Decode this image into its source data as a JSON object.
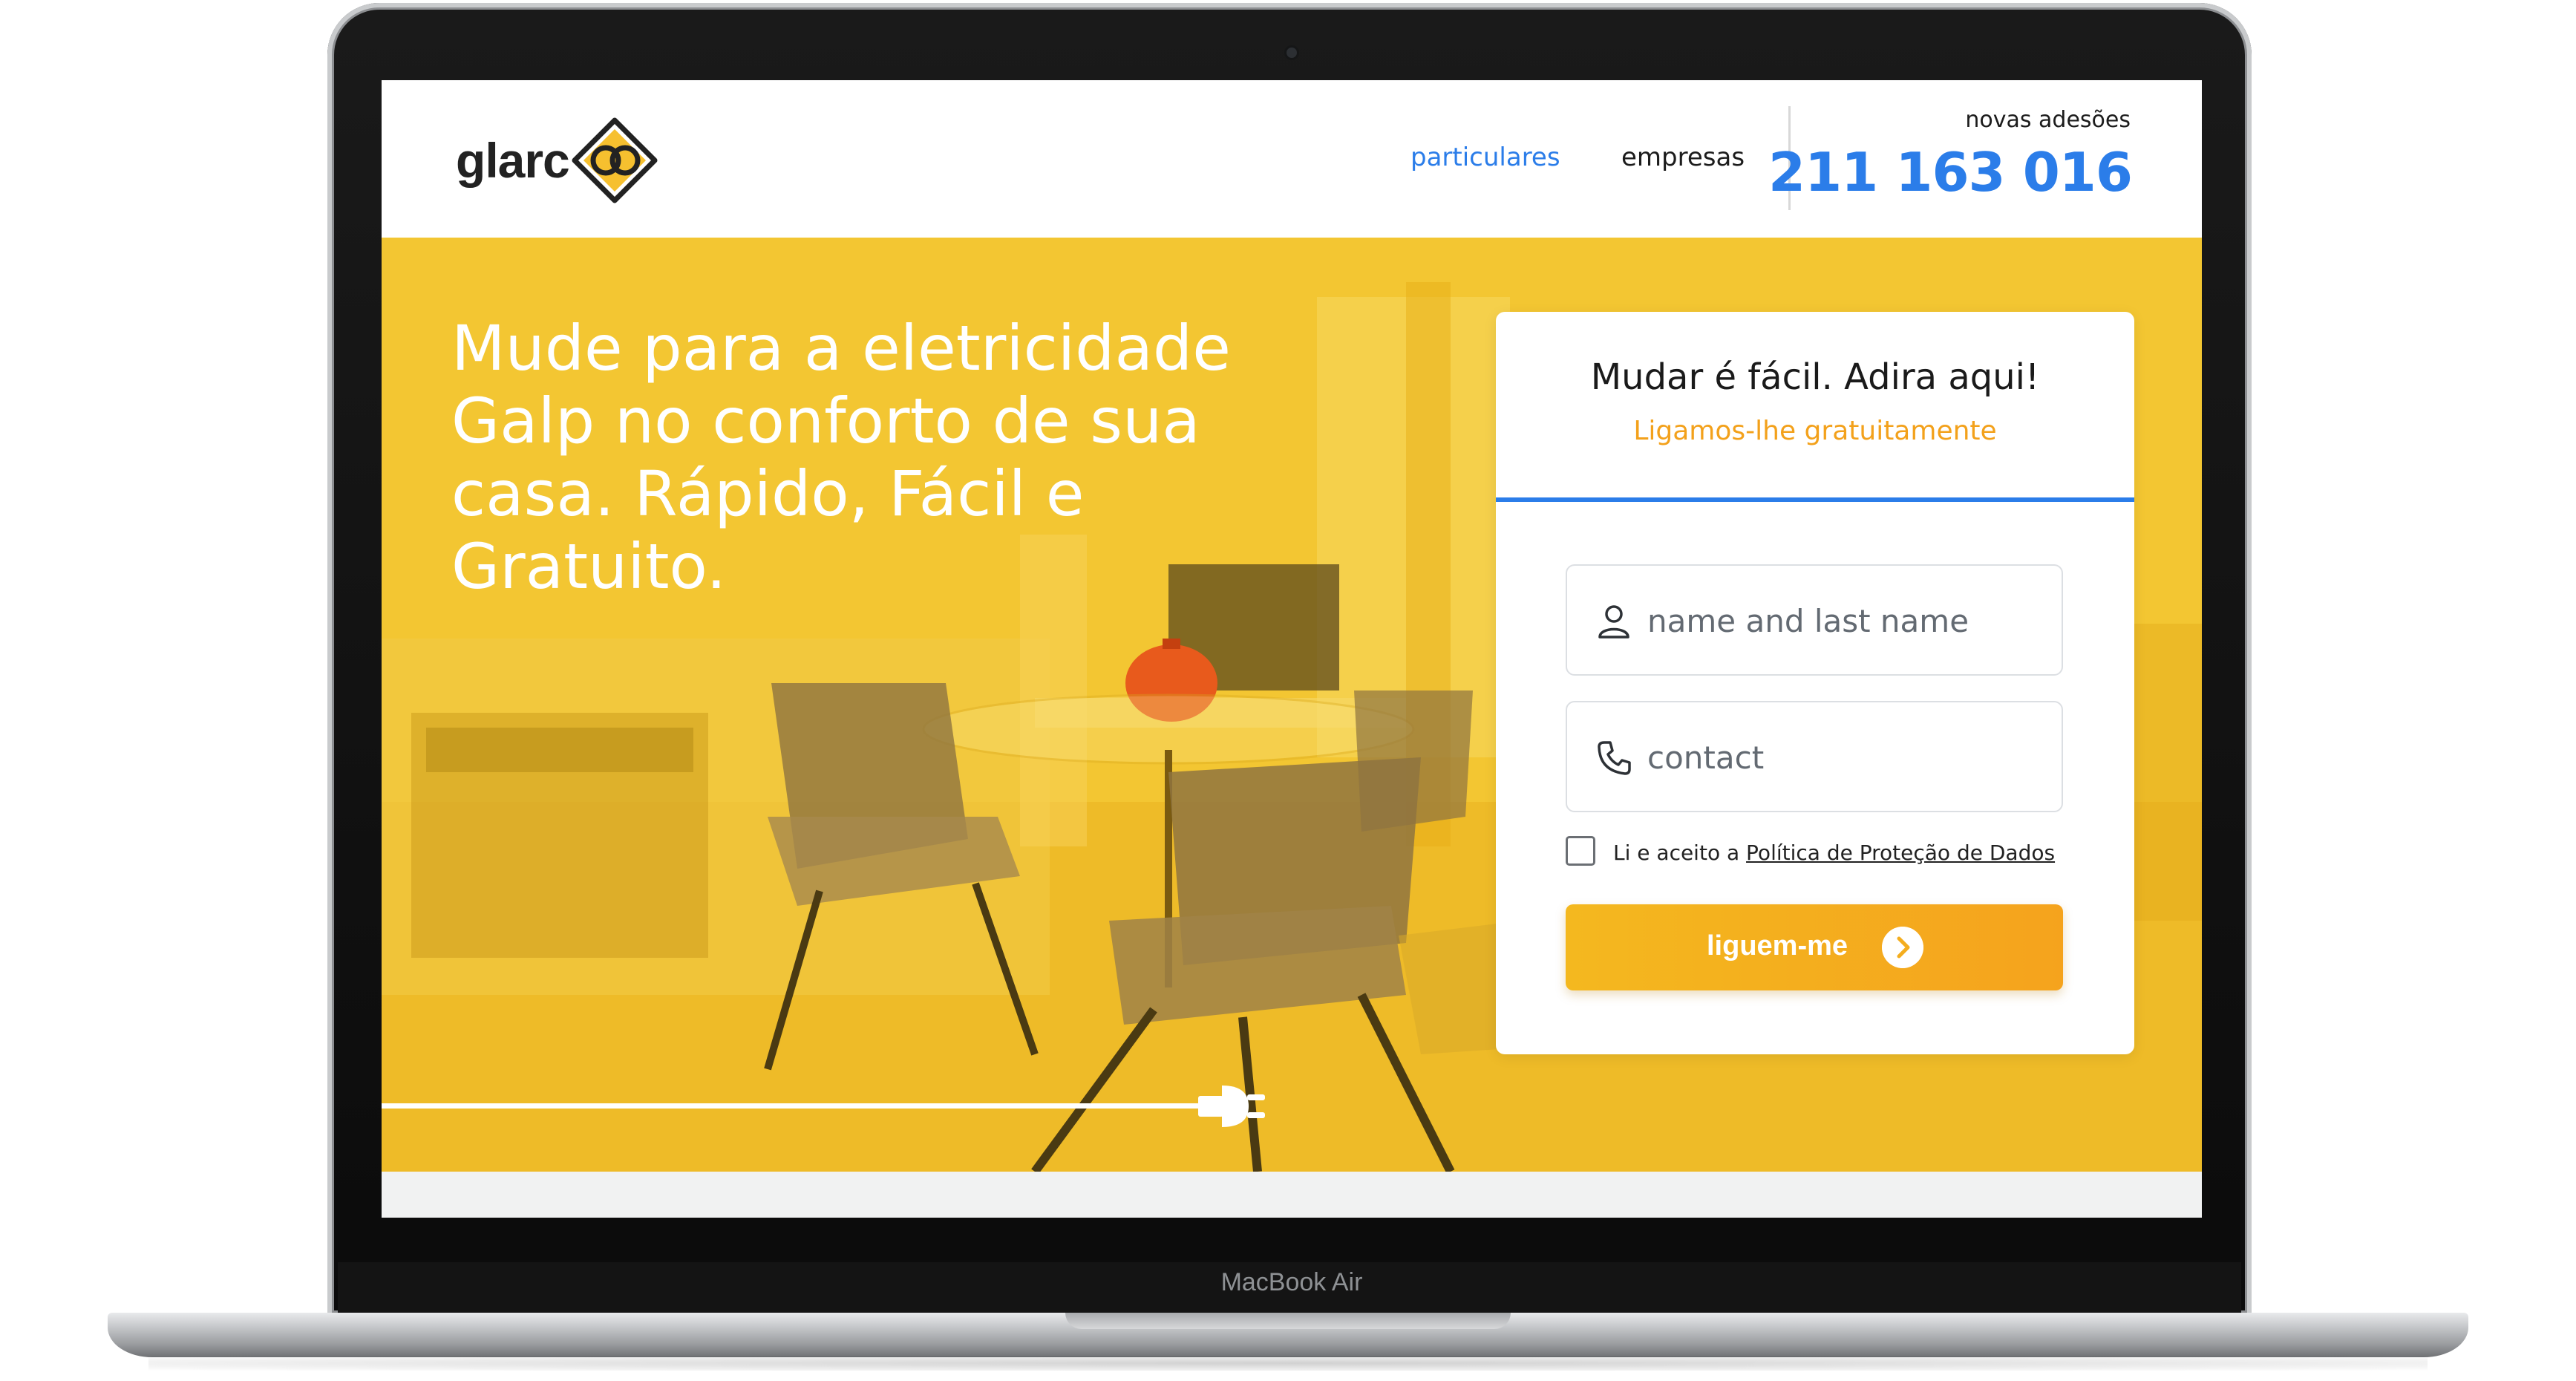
{
  "device": {
    "model_label": "MacBook Air"
  },
  "header": {
    "logo_text": "glarc",
    "nav": [
      {
        "label": "particulares",
        "active": true
      },
      {
        "label": "empresas",
        "active": false
      }
    ],
    "adesoes_label": "novas adesões",
    "phone": "211 163 016"
  },
  "hero": {
    "title": "Mude para a eletricidade Galp no conforto de sua casa. Rápido, Fácil e Gratuito."
  },
  "form": {
    "title": "Mudar é fácil. Adira aqui!",
    "subtitle": "Ligamos-lhe gratuitamente",
    "name_placeholder": "name and last name",
    "contact_placeholder": "contact",
    "consent_prefix": "Li e aceito a ",
    "consent_link": "Política de Proteção de Dados",
    "consent_checked": false,
    "submit_label": "liguem-me"
  },
  "colors": {
    "brand_yellow": "#f2c230",
    "accent_blue": "#2b7de9",
    "accent_orange": "#f3a11b",
    "cta_gradient": [
      "#f4b81f",
      "#f5a31d"
    ]
  },
  "icons": [
    "logo-mark-icon",
    "user-icon",
    "phone-icon",
    "plug-icon",
    "chevron-right-icon",
    "camera-icon"
  ]
}
